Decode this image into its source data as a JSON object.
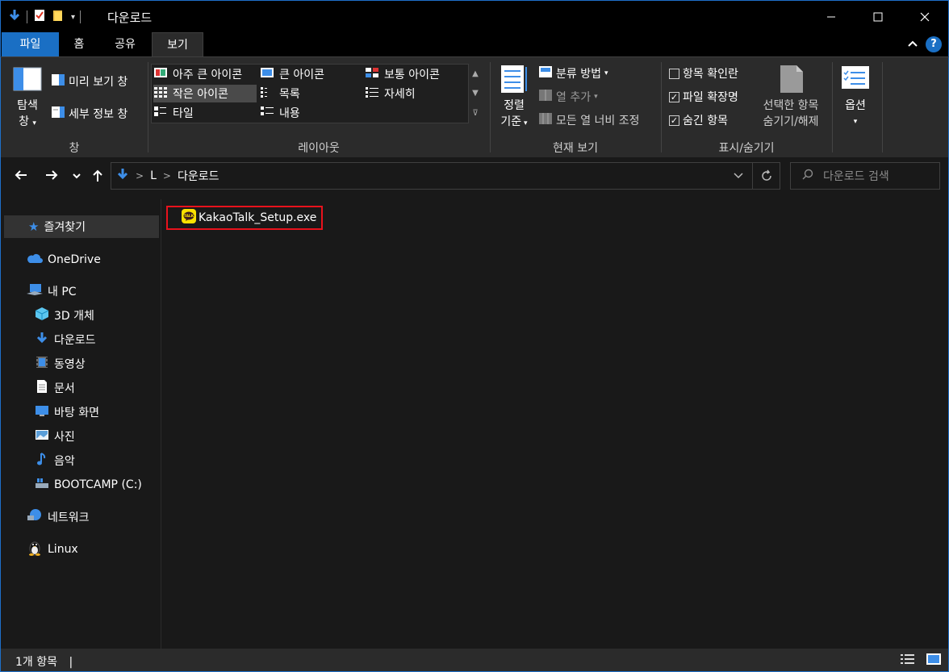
{
  "window": {
    "title": "다운로드"
  },
  "tabs": {
    "file": "파일",
    "home": "홈",
    "share": "공유",
    "view": "보기"
  },
  "ribbon": {
    "panes": {
      "nav_pane_line1": "탐색",
      "nav_pane_line2": "창",
      "preview_pane": "미리 보기 창",
      "details_pane": "세부 정보 창",
      "group_label": "창"
    },
    "layout": {
      "extra_large_icons": "아주 큰 아이콘",
      "large_icons": "큰 아이콘",
      "medium_icons": "보통 아이콘",
      "small_icons": "작은 아이콘",
      "list": "목록",
      "details": "자세히",
      "tiles": "타일",
      "content": "내용",
      "group_label": "레이아웃",
      "selected": "small_icons"
    },
    "current_view": {
      "sort_line1": "정렬",
      "sort_line2": "기준",
      "group_by": "분류 방법",
      "add_columns": "열 추가",
      "size_all_columns": "모든 열 너비 조정",
      "group_label": "현재 보기"
    },
    "show_hide": {
      "item_checkboxes": "항목 확인란",
      "item_checkboxes_checked": false,
      "file_extensions": "파일 확장명",
      "file_extensions_checked": true,
      "hidden_items": "숨긴 항목",
      "hidden_items_checked": true,
      "hide_selected_line1": "선택한 항목",
      "hide_selected_line2": "숨기기/해제",
      "group_label": "표시/숨기기"
    },
    "options": {
      "label": "옵션"
    }
  },
  "address": {
    "crumbs": [
      "L",
      "다운로드"
    ]
  },
  "search": {
    "placeholder": "다운로드 검색"
  },
  "nav_pane": {
    "quick_access": "즐겨찾기",
    "onedrive": "OneDrive",
    "this_pc": "내 PC",
    "pc_items": [
      {
        "label": "3D 개체",
        "icon": "3d-objects-icon"
      },
      {
        "label": "다운로드",
        "icon": "downloads-icon"
      },
      {
        "label": "동영상",
        "icon": "videos-icon"
      },
      {
        "label": "문서",
        "icon": "documents-icon"
      },
      {
        "label": "바탕 화면",
        "icon": "desktop-icon"
      },
      {
        "label": "사진",
        "icon": "pictures-icon"
      },
      {
        "label": "음악",
        "icon": "music-icon"
      },
      {
        "label": "BOOTCAMP (C:)",
        "icon": "drive-icon"
      }
    ],
    "network": "네트워크",
    "linux": "Linux"
  },
  "files": [
    {
      "name": "KakaoTalk_Setup.exe",
      "icon": "kakaotalk-icon"
    }
  ],
  "status": {
    "count": "1개 항목"
  },
  "colors": {
    "accent": "#1a6fc4",
    "highlight": "#e8121c",
    "background": "#191919",
    "ribbon": "#2b2b2b"
  }
}
